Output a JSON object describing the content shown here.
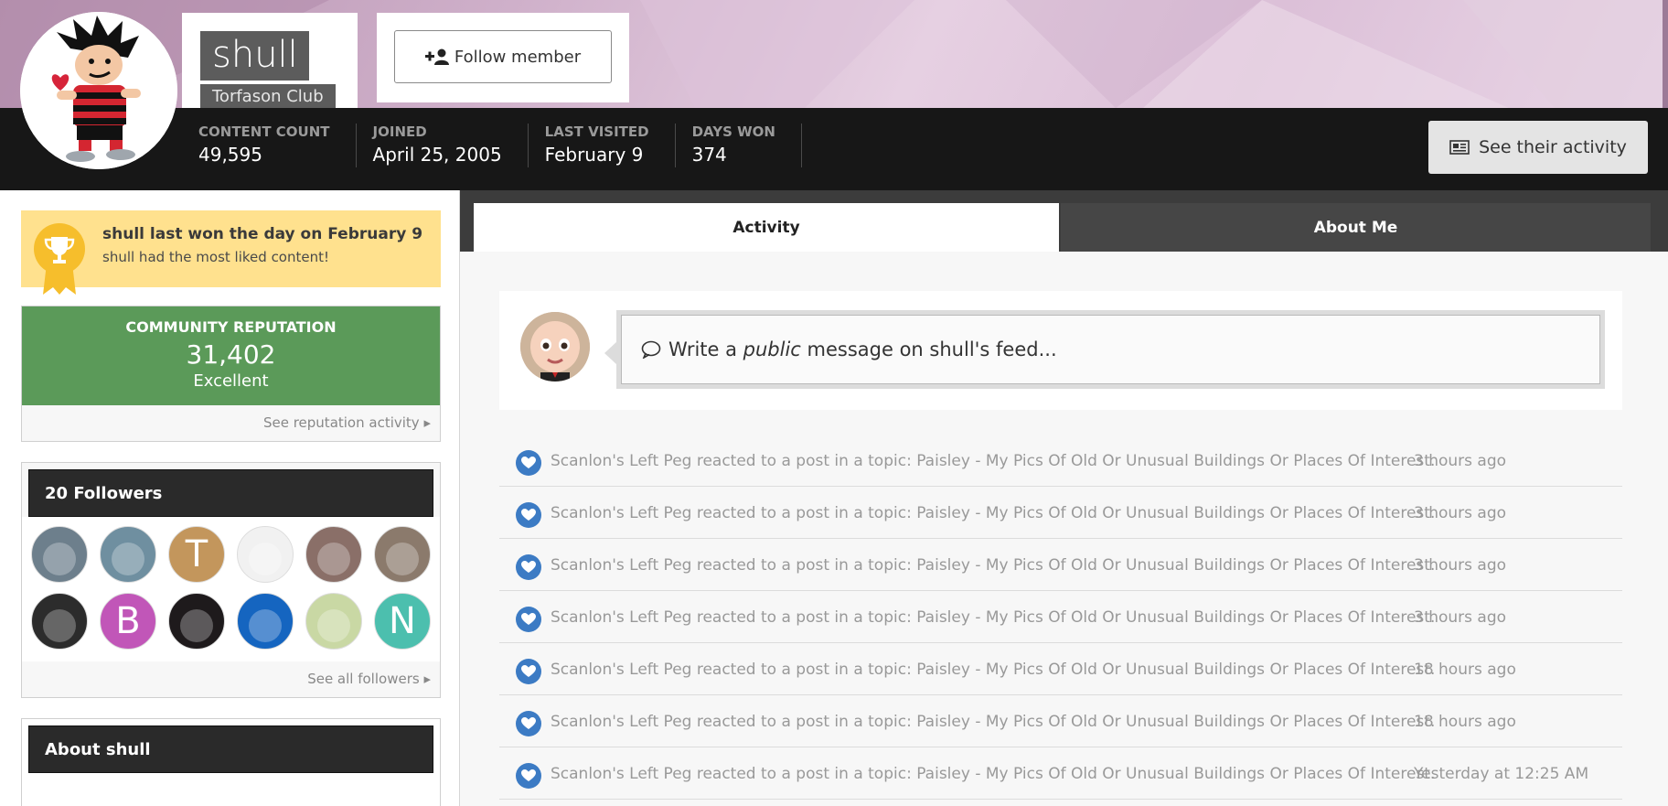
{
  "profile": {
    "username": "shull",
    "group": "Torfason Club",
    "follow_label": "Follow member",
    "activity_button_label": "See their activity"
  },
  "stats": [
    {
      "label": "CONTENT COUNT",
      "value": "49,595"
    },
    {
      "label": "JOINED",
      "value": "April 25, 2005"
    },
    {
      "label": "LAST VISITED",
      "value": "February 9"
    },
    {
      "label": "DAYS WON",
      "value": "374"
    }
  ],
  "day_win": {
    "title": "shull last won the day on February 9",
    "subtitle": "shull had the most liked content!"
  },
  "reputation": {
    "label": "COMMUNITY REPUTATION",
    "value": "31,402",
    "level": "Excellent",
    "link": "See reputation activity"
  },
  "followers": {
    "title": "20 Followers",
    "link": "See all followers",
    "avatars": [
      {
        "kind": "photo",
        "color": "#6d7f8c"
      },
      {
        "kind": "photo",
        "color": "#6f8fa0"
      },
      {
        "kind": "letter",
        "letter": "T",
        "color": "#c3965c"
      },
      {
        "kind": "photo",
        "color": "#f1f1f1"
      },
      {
        "kind": "photo",
        "color": "#8a6f68"
      },
      {
        "kind": "photo",
        "color": "#8b7a6c"
      },
      {
        "kind": "photo",
        "color": "#2c2c2c"
      },
      {
        "kind": "letter",
        "letter": "B",
        "color": "#c156b8"
      },
      {
        "kind": "photo",
        "color": "#1e1a1c"
      },
      {
        "kind": "photo",
        "color": "#1565c0"
      },
      {
        "kind": "photo",
        "color": "#c9d8a4"
      },
      {
        "kind": "letter",
        "letter": "N",
        "color": "#4cbfae"
      }
    ]
  },
  "about": {
    "title": "About shull"
  },
  "tabs": {
    "activity": "Activity",
    "about": "About Me"
  },
  "composer": {
    "prefix": "Write a ",
    "emphasis": "public",
    "suffix": " message on shull's feed..."
  },
  "feed": [
    {
      "text": "Scanlon's Left Peg reacted to a post in a topic: Paisley - My Pics Of Old Or Unusual Buildings Or Places Of Interest.",
      "time": "3 hours ago"
    },
    {
      "text": "Scanlon's Left Peg reacted to a post in a topic: Paisley - My Pics Of Old Or Unusual Buildings Or Places Of Interest.",
      "time": "3 hours ago"
    },
    {
      "text": "Scanlon's Left Peg reacted to a post in a topic: Paisley - My Pics Of Old Or Unusual Buildings Or Places Of Interest.",
      "time": "3 hours ago"
    },
    {
      "text": "Scanlon's Left Peg reacted to a post in a topic: Paisley - My Pics Of Old Or Unusual Buildings Or Places Of Interest.",
      "time": "3 hours ago"
    },
    {
      "text": "Scanlon's Left Peg reacted to a post in a topic: Paisley - My Pics Of Old Or Unusual Buildings Or Places Of Interest.",
      "time": "18 hours ago"
    },
    {
      "text": "Scanlon's Left Peg reacted to a post in a topic: Paisley - My Pics Of Old Or Unusual Buildings Or Places Of Interest.",
      "time": "18 hours ago"
    },
    {
      "text": "Scanlon's Left Peg reacted to a post in a topic: Paisley - My Pics Of Old Or Unusual Buildings Or Places Of Interest.",
      "time": "Yesterday at 12:25 AM"
    }
  ],
  "colors": {
    "reputation_green": "#5b9a59",
    "day_win_yellow": "#ffe18e",
    "reaction_blue": "#3c7bc4",
    "header_dark": "#171717"
  }
}
